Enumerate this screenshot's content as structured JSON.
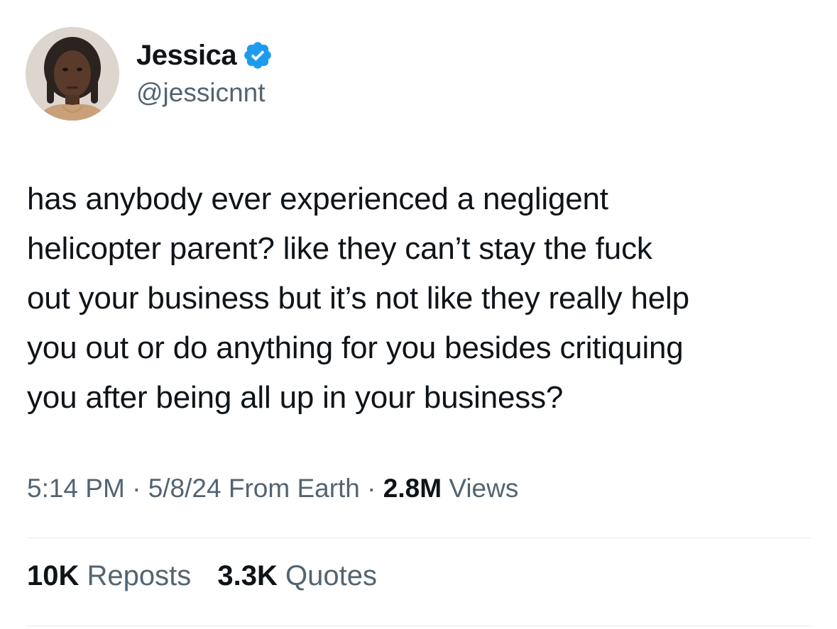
{
  "author": {
    "display_name": "Jessica",
    "handle": "@jessicnnt",
    "verified_icon": "verified-badge-icon",
    "verified_color": "#1d9bf0"
  },
  "tweet": {
    "lines": [
      "has anybody ever experienced a negligent",
      "helicopter parent? like they can’t stay the fuck",
      "out your business but it’s not like they really help",
      "you out or do anything for you besides critiquing",
      "you after being all up in your business?"
    ]
  },
  "meta": {
    "time": "5:14 PM",
    "sep1": " · ",
    "date": "5/8/24",
    "source": " From Earth",
    "sep2": " · ",
    "views_count": "2.8M",
    "views_label": " Views"
  },
  "stats": {
    "reposts_count": "10K",
    "reposts_label": " Reposts",
    "quotes_count": "3.3K",
    "quotes_label": " Quotes"
  },
  "colors": {
    "text_primary": "#0f1419",
    "text_secondary": "#536471",
    "divider": "#e6e9ec"
  }
}
